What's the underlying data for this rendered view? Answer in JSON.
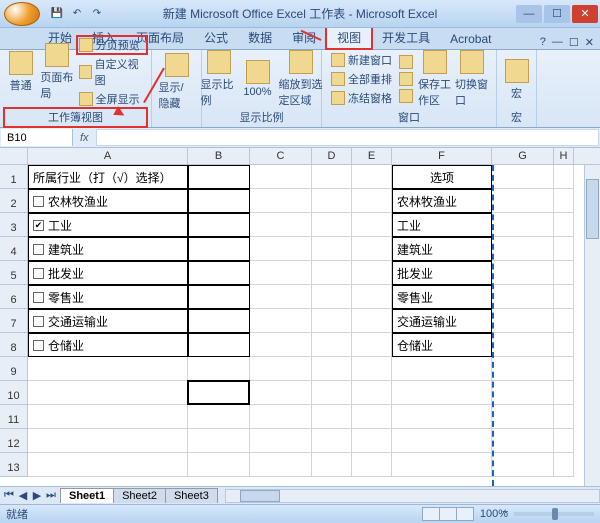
{
  "title": "新建 Microsoft Office Excel 工作表 - Microsoft Excel",
  "tabs": {
    "t0": "开始",
    "t1": "插入",
    "t2": "页面布局",
    "t3": "公式",
    "t4": "数据",
    "t5": "审阅",
    "t6": "视图",
    "t7": "开发工具",
    "t8": "Acrobat"
  },
  "ribbon": {
    "views": {
      "normal": "普通",
      "layout": "页面布局",
      "pagebreak": "分页预览",
      "custom": "自定义视图",
      "fullscreen": "全屏显示",
      "group": "工作簿视图"
    },
    "show": {
      "showhide": "显示/隐藏"
    },
    "zoom": {
      "zoom": "显示比例",
      "hundred": "100%",
      "toselection": "缩放到选定区域",
      "group": "显示比例"
    },
    "window": {
      "newwin": "新建窗口",
      "arrange": "全部重排",
      "freeze": "冻结窗格",
      "save": "保存工作区",
      "switch": "切换窗口",
      "group": "窗口"
    },
    "macros": {
      "macro": "宏",
      "group": "宏"
    }
  },
  "namebox": "B10",
  "columns": {
    "A": "A",
    "B": "B",
    "C": "C",
    "D": "D",
    "E": "E",
    "F": "F",
    "G": "G",
    "H": "H"
  },
  "rows": [
    "1",
    "2",
    "3",
    "4",
    "5",
    "6",
    "7",
    "8",
    "9",
    "10",
    "11",
    "12",
    "13"
  ],
  "cells": {
    "A1": "所属行业（打（√）选择）",
    "A2": "农林牧渔业",
    "A3": "工业",
    "A4": "建筑业",
    "A5": "批发业",
    "A6": "零售业",
    "A7": "交通运输业",
    "A8": "仓储业",
    "F1": "选项",
    "F2": "农林牧渔业",
    "F3": "工业",
    "F4": "建筑业",
    "F5": "批发业",
    "F6": "零售业",
    "F7": "交通运输业",
    "F8": "仓储业"
  },
  "checks": {
    "A3": true
  },
  "sheets": {
    "s1": "Sheet1",
    "s2": "Sheet2",
    "s3": "Sheet3"
  },
  "status": {
    "ready": "就绪",
    "zoom": "100%"
  }
}
